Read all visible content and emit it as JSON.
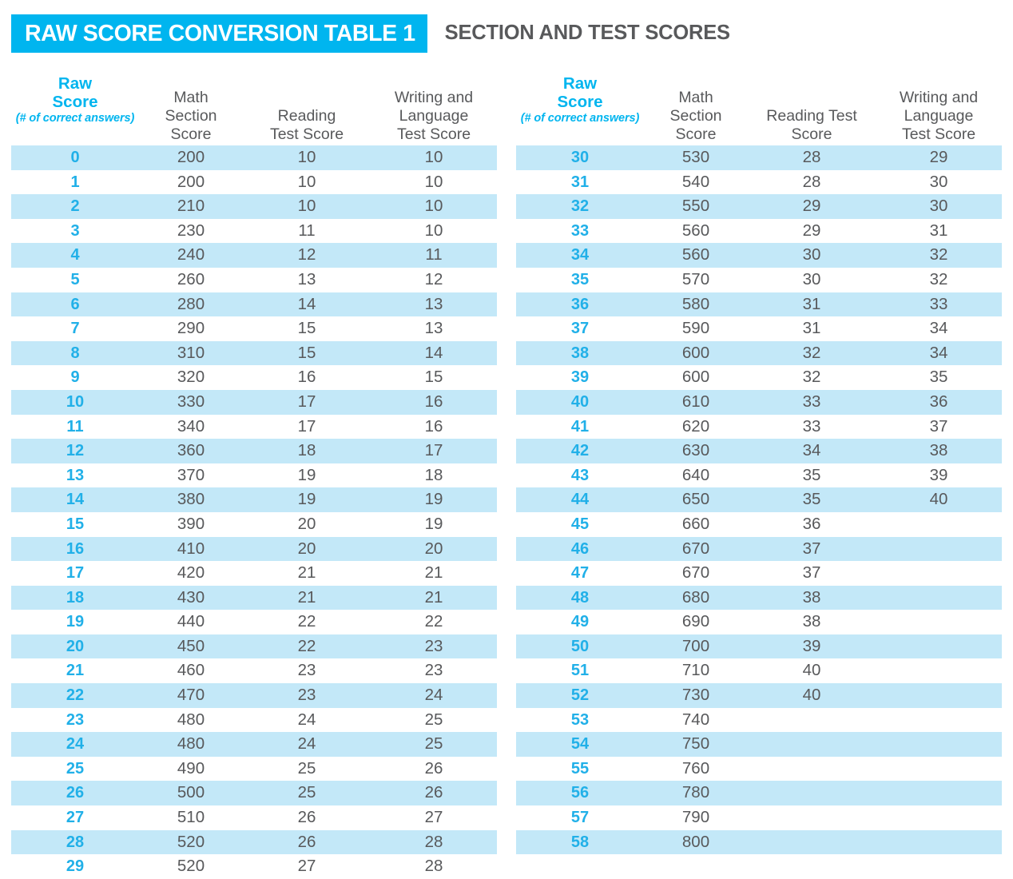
{
  "title": {
    "badge": "RAW SCORE CONVERSION TABLE 1",
    "subtitle": "SECTION AND TEST SCORES"
  },
  "colors": {
    "accent_blue": "#00b5ef",
    "row_shade": "#c3e8f8",
    "text_gray": "#58595b",
    "raw_score_blue": "#21b0e8"
  },
  "columns": {
    "raw_score": "Raw\nScore",
    "raw_score_sub": "(# of correct answers)",
    "math": "Math\nSection\nScore",
    "reading_left": "Reading\nTest Score",
    "reading_right": "Reading Test\nScore",
    "writing": "Writing and\nLanguage\nTest Score"
  },
  "chart_data": {
    "type": "table",
    "title": "RAW SCORE CONVERSION TABLE 1 — SECTION AND TEST SCORES",
    "columns": [
      "Raw Score (# of correct answers)",
      "Math Section Score",
      "Reading Test Score",
      "Writing and Language Test Score"
    ],
    "left_table": [
      [
        "0",
        "200",
        "10",
        "10"
      ],
      [
        "1",
        "200",
        "10",
        "10"
      ],
      [
        "2",
        "210",
        "10",
        "10"
      ],
      [
        "3",
        "230",
        "11",
        "10"
      ],
      [
        "4",
        "240",
        "12",
        "11"
      ],
      [
        "5",
        "260",
        "13",
        "12"
      ],
      [
        "6",
        "280",
        "14",
        "13"
      ],
      [
        "7",
        "290",
        "15",
        "13"
      ],
      [
        "8",
        "310",
        "15",
        "14"
      ],
      [
        "9",
        "320",
        "16",
        "15"
      ],
      [
        "10",
        "330",
        "17",
        "16"
      ],
      [
        "11",
        "340",
        "17",
        "16"
      ],
      [
        "12",
        "360",
        "18",
        "17"
      ],
      [
        "13",
        "370",
        "19",
        "18"
      ],
      [
        "14",
        "380",
        "19",
        "19"
      ],
      [
        "15",
        "390",
        "20",
        "19"
      ],
      [
        "16",
        "410",
        "20",
        "20"
      ],
      [
        "17",
        "420",
        "21",
        "21"
      ],
      [
        "18",
        "430",
        "21",
        "21"
      ],
      [
        "19",
        "440",
        "22",
        "22"
      ],
      [
        "20",
        "450",
        "22",
        "23"
      ],
      [
        "21",
        "460",
        "23",
        "23"
      ],
      [
        "22",
        "470",
        "23",
        "24"
      ],
      [
        "23",
        "480",
        "24",
        "25"
      ],
      [
        "24",
        "480",
        "24",
        "25"
      ],
      [
        "25",
        "490",
        "25",
        "26"
      ],
      [
        "26",
        "500",
        "25",
        "26"
      ],
      [
        "27",
        "510",
        "26",
        "27"
      ],
      [
        "28",
        "520",
        "26",
        "28"
      ],
      [
        "29",
        "520",
        "27",
        "28"
      ]
    ],
    "right_table": [
      [
        "30",
        "530",
        "28",
        "29"
      ],
      [
        "31",
        "540",
        "28",
        "30"
      ],
      [
        "32",
        "550",
        "29",
        "30"
      ],
      [
        "33",
        "560",
        "29",
        "31"
      ],
      [
        "34",
        "560",
        "30",
        "32"
      ],
      [
        "35",
        "570",
        "30",
        "32"
      ],
      [
        "36",
        "580",
        "31",
        "33"
      ],
      [
        "37",
        "590",
        "31",
        "34"
      ],
      [
        "38",
        "600",
        "32",
        "34"
      ],
      [
        "39",
        "600",
        "32",
        "35"
      ],
      [
        "40",
        "610",
        "33",
        "36"
      ],
      [
        "41",
        "620",
        "33",
        "37"
      ],
      [
        "42",
        "630",
        "34",
        "38"
      ],
      [
        "43",
        "640",
        "35",
        "39"
      ],
      [
        "44",
        "650",
        "35",
        "40"
      ],
      [
        "45",
        "660",
        "36",
        ""
      ],
      [
        "46",
        "670",
        "37",
        ""
      ],
      [
        "47",
        "670",
        "37",
        ""
      ],
      [
        "48",
        "680",
        "38",
        ""
      ],
      [
        "49",
        "690",
        "38",
        ""
      ],
      [
        "50",
        "700",
        "39",
        ""
      ],
      [
        "51",
        "710",
        "40",
        ""
      ],
      [
        "52",
        "730",
        "40",
        ""
      ],
      [
        "53",
        "740",
        "",
        ""
      ],
      [
        "54",
        "750",
        "",
        ""
      ],
      [
        "55",
        "760",
        "",
        ""
      ],
      [
        "56",
        "780",
        "",
        ""
      ],
      [
        "57",
        "790",
        "",
        ""
      ],
      [
        "58",
        "800",
        "",
        ""
      ]
    ]
  }
}
